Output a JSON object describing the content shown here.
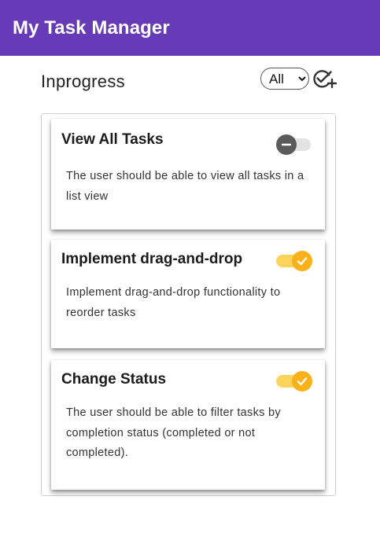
{
  "app": {
    "title": "My Task Manager"
  },
  "section": {
    "title": "Inprogress"
  },
  "filter": {
    "selected": "All",
    "options": [
      "All"
    ]
  },
  "icons": {
    "add_task": "add-task-check-icon"
  },
  "colors": {
    "app_bar": "#673ab7",
    "toggle_on": "#fbb11a",
    "toggle_off": "#5b5b5b"
  },
  "tasks": [
    {
      "title": "View All Tasks",
      "description": "The user should be able to view all tasks in a list view",
      "completed": false
    },
    {
      "title": "Implement drag-and-drop",
      "description": "Implement drag-and-drop functionality to reorder tasks",
      "completed": true
    },
    {
      "title": "Change Status",
      "description": "The user should be able to filter tasks by completion status (completed or not completed).",
      "completed": true
    }
  ]
}
